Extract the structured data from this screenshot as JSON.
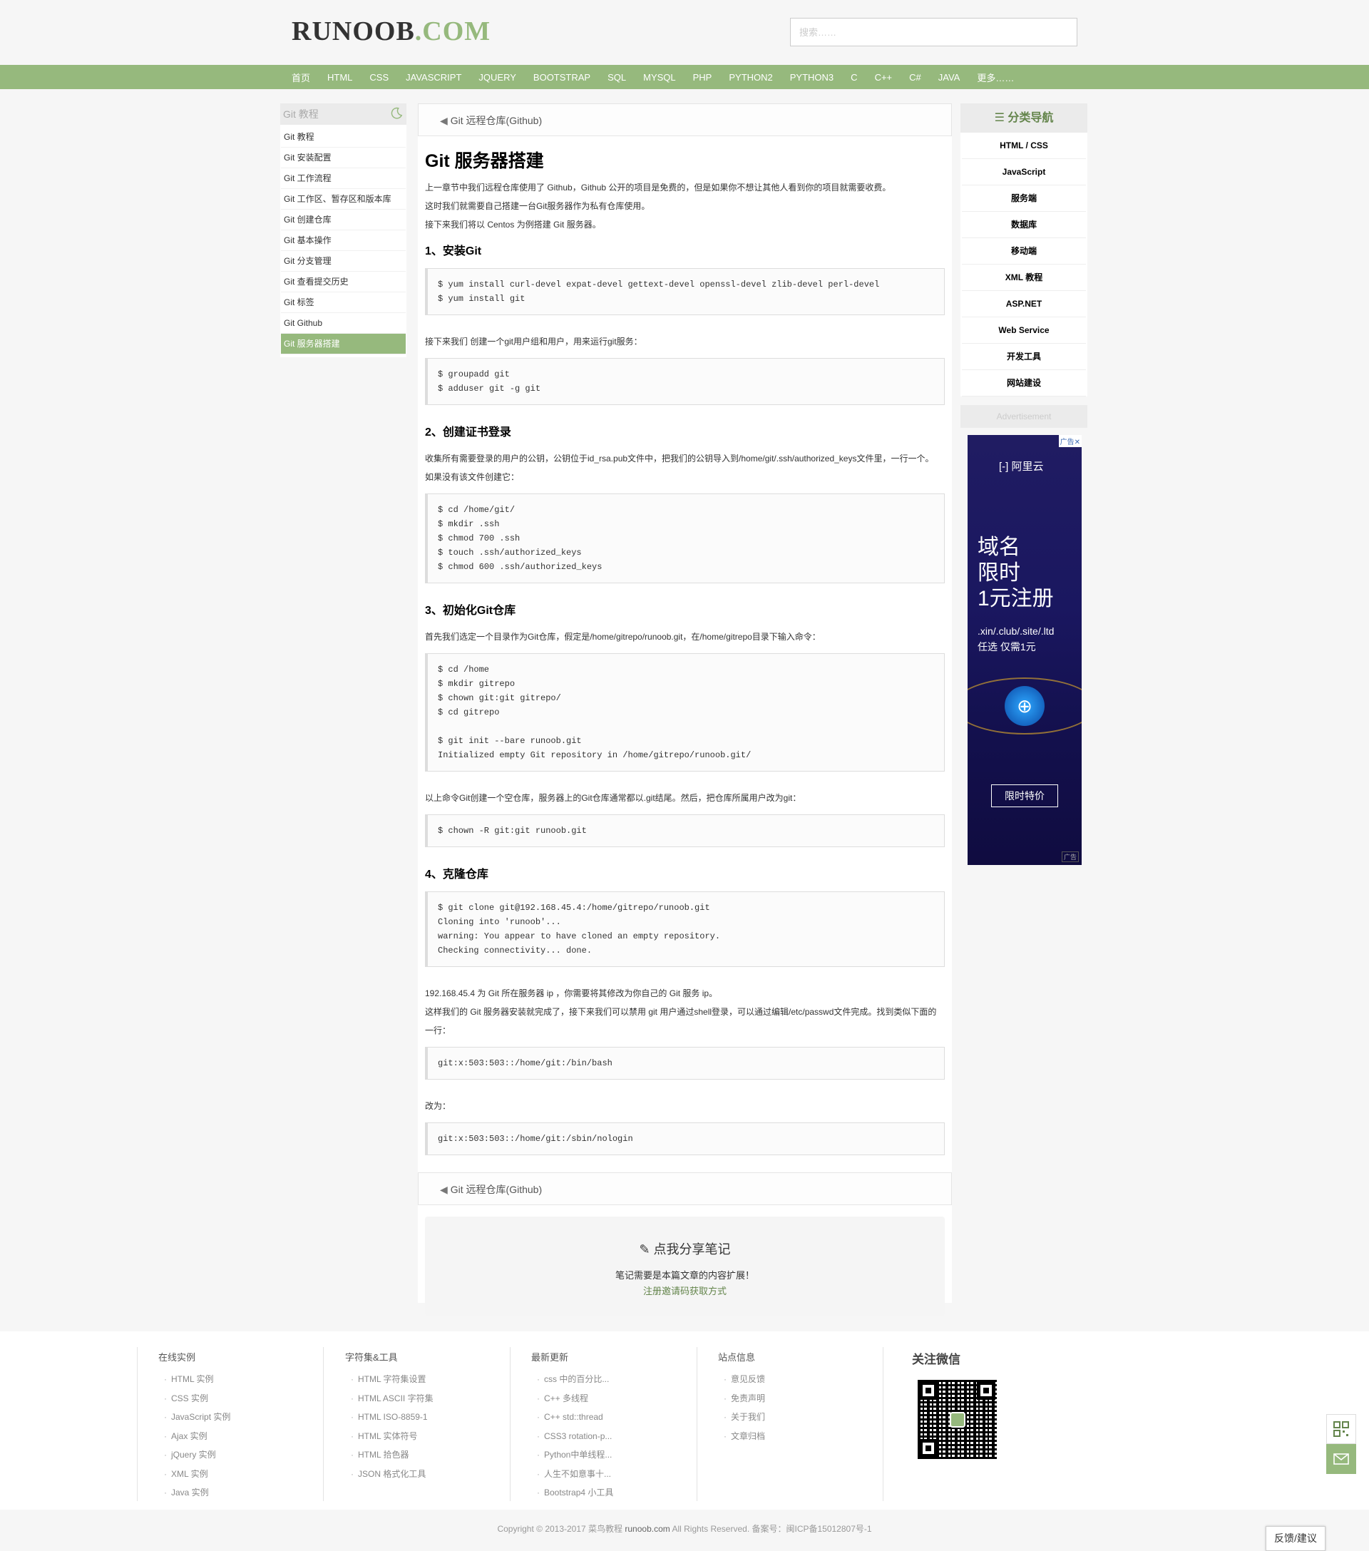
{
  "header": {
    "logo_main": "RUNOOB",
    "logo_dot": ".COM",
    "search_placeholder": "搜索……"
  },
  "nav": [
    "首页",
    "HTML",
    "CSS",
    "JAVASCRIPT",
    "JQUERY",
    "BOOTSTRAP",
    "SQL",
    "MYSQL",
    "PHP",
    "PYTHON2",
    "PYTHON3",
    "C",
    "C++",
    "C#",
    "JAVA",
    "更多……"
  ],
  "sidebar": {
    "title": "Git 教程",
    "items": [
      "Git 教程",
      "Git 安装配置",
      "Git 工作流程",
      "Git 工作区、暂存区和版本库",
      "Git 创建仓库",
      "Git 基本操作",
      "Git 分支管理",
      "Git 查看提交历史",
      "Git 标签",
      "Git Github",
      "Git 服务器搭建"
    ],
    "active_index": 10
  },
  "main": {
    "prev_link": "Git 远程仓库(Github)",
    "title": "Git 服务器搭建",
    "intro": [
      "上一章节中我们远程仓库使用了 Github，Github 公开的项目是免费的，但是如果你不想让其他人看到你的项目就需要收费。",
      "这时我们就需要自己搭建一台Git服务器作为私有仓库使用。",
      "接下来我们将以 Centos 为例搭建 Git 服务器。"
    ],
    "s1_title": "1、安装Git",
    "s1_code": "$ yum install curl-devel expat-devel gettext-devel openssl-devel zlib-devel perl-devel\n$ yum install git",
    "s1_text": "接下来我们 创建一个git用户组和用户，用来运行git服务：",
    "s1_code2": "$ groupadd git\n$ adduser git -g git",
    "s2_title": "2、创建证书登录",
    "s2_text1": "收集所有需要登录的用户的公钥，公钥位于id_rsa.pub文件中，把我们的公钥导入到/home/git/.ssh/authorized_keys文件里，一行一个。",
    "s2_text2": "如果没有该文件创建它：",
    "s2_code": "$ cd /home/git/\n$ mkdir .ssh\n$ chmod 700 .ssh\n$ touch .ssh/authorized_keys\n$ chmod 600 .ssh/authorized_keys",
    "s3_title": "3、初始化Git仓库",
    "s3_text1": "首先我们选定一个目录作为Git仓库，假定是/home/gitrepo/runoob.git，在/home/gitrepo目录下输入命令：",
    "s3_code": "$ cd /home\n$ mkdir gitrepo\n$ chown git:git gitrepo/\n$ cd gitrepo\n\n$ git init --bare runoob.git\nInitialized empty Git repository in /home/gitrepo/runoob.git/",
    "s3_text2": "以上命令Git创建一个空仓库，服务器上的Git仓库通常都以.git结尾。然后，把仓库所属用户改为git：",
    "s3_code2": "$ chown -R git:git runoob.git",
    "s4_title": "4、克隆仓库",
    "s4_code": "$ git clone git@192.168.45.4:/home/gitrepo/runoob.git\nCloning into 'runoob'...\nwarning: You appear to have cloned an empty repository.\nChecking connectivity... done.",
    "s4_text1": "192.168.45.4 为 Git 所在服务器 ip ，你需要将其修改为你自己的 Git 服务 ip。",
    "s4_text2": "这样我们的 Git 服务器安装就完成了，接下来我们可以禁用 git 用户通过shell登录，可以通过编辑/etc/passwd文件完成。找到类似下面的一行：",
    "s4_code2": "git:x:503:503::/home/git:/bin/bash",
    "s4_text3": "改为：",
    "s4_code3": "git:x:503:503::/home/git:/sbin/nologin",
    "bottom_prev": "Git 远程仓库(Github)",
    "note_title": "点我分享笔记",
    "note_sub": "笔记需要是本篇文章的内容扩展！",
    "note_link": "注册邀请码获取方式"
  },
  "right": {
    "cat_title": "分类导航",
    "cats": [
      "HTML / CSS",
      "JavaScript",
      "服务端",
      "数据库",
      "移动端",
      "XML 教程",
      "ASP.NET",
      "Web Service",
      "开发工具",
      "网站建设"
    ],
    "adv_title": "Advertisement",
    "ad": {
      "badge": "广告",
      "brand": "阿里云",
      "line1": "域名",
      "line2": "限时",
      "line3": "1元注册",
      "sub1": ".xin/.club/.site/.ltd",
      "sub2": "任选 仅需1元",
      "button": "限时特价",
      "tag": "广告"
    }
  },
  "footer": {
    "cols": [
      {
        "title": "在线实例",
        "items": [
          "HTML 实例",
          "CSS 实例",
          "JavaScript 实例",
          "Ajax 实例",
          "jQuery 实例",
          "XML 实例",
          "Java 实例"
        ]
      },
      {
        "title": "字符集&工具",
        "items": [
          "HTML 字符集设置",
          "HTML ASCII 字符集",
          "HTML ISO-8859-1",
          "HTML 实体符号",
          "HTML 拾色器",
          "JSON 格式化工具"
        ]
      },
      {
        "title": "最新更新",
        "items": [
          "css 中的百分比...",
          "C++ 多线程",
          "C++ std::thread",
          "CSS3 rotation-p...",
          "Python中单线程...",
          "人生不如意事十...",
          "Bootstrap4 小工具"
        ]
      },
      {
        "title": "站点信息",
        "items": [
          "意见反馈",
          "免责声明",
          "关于我们",
          "文章归档"
        ]
      }
    ],
    "wechat_title": "关注微信",
    "copyright_pre": "Copyright © 2013-2017 菜鸟教程 ",
    "copyright_site": "runoob.com",
    "copyright_post": " All Rights Reserved. 备案号：闽ICP备15012807号-1",
    "feedback": "反馈/建议"
  },
  "colors": {
    "accent": "#96b97d",
    "accent_dark": "#64854c"
  }
}
